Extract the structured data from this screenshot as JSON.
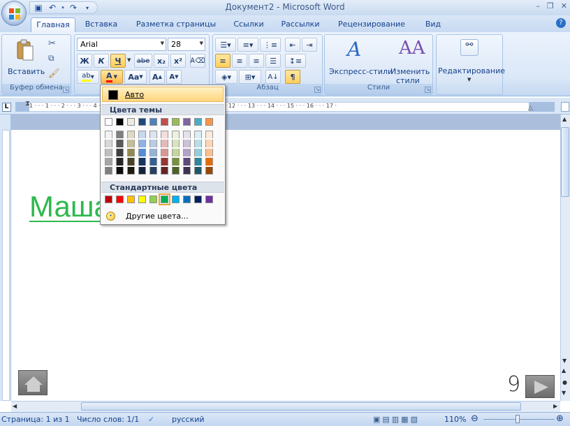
{
  "window": {
    "title": "Документ2 - Microsoft Word"
  },
  "tabs": [
    "Главная",
    "Вставка",
    "Разметка страницы",
    "Ссылки",
    "Рассылки",
    "Рецензирование",
    "Вид"
  ],
  "ribbon": {
    "clipboard": {
      "paste_label": "Вставить",
      "group_label": "Буфер обмена"
    },
    "font": {
      "name": "Arial",
      "size": "28",
      "bold": "Ж",
      "italic": "К",
      "underline": "Ч",
      "strike": "abe",
      "sub": "x₂",
      "sup": "x²",
      "font_color_letter": "A",
      "case": "Aa",
      "grow": "A",
      "shrink": "A"
    },
    "paragraph": {
      "group_label": "Абзац"
    },
    "styles": {
      "express_label": "Экспресс-стили",
      "change_label": "Изменить",
      "change_label2": "стили",
      "group_label": "Стили"
    },
    "editing": {
      "label": "Редактирование"
    }
  },
  "color_menu": {
    "auto_label": "Авто",
    "theme_header": "Цвета темы",
    "standard_header": "Стандартные цвета",
    "more_label": "Другие цвета...",
    "theme_colors": [
      "#ffffff",
      "#000000",
      "#eeece1",
      "#1f497d",
      "#4f81bd",
      "#c0504d",
      "#9bbb59",
      "#8064a2",
      "#4bacc6",
      "#f79646"
    ],
    "theme_shades": [
      [
        "#f2f2f2",
        "#d8d8d8",
        "#bfbfbf",
        "#a5a5a5",
        "#7f7f7f"
      ],
      [
        "#7f7f7f",
        "#595959",
        "#3f3f3f",
        "#262626",
        "#0c0c0c"
      ],
      [
        "#ddd9c3",
        "#c4bd97",
        "#938953",
        "#494429",
        "#1d1b10"
      ],
      [
        "#c6d9f0",
        "#8db3e2",
        "#548dd4",
        "#17365d",
        "#0f243e"
      ],
      [
        "#dbe5f1",
        "#b8cce4",
        "#95b3d7",
        "#366092",
        "#244061"
      ],
      [
        "#f2dcdb",
        "#e5b9b7",
        "#d99694",
        "#953734",
        "#632423"
      ],
      [
        "#ebf1dd",
        "#d7e3bc",
        "#c3d69b",
        "#76923c",
        "#4f6128"
      ],
      [
        "#e5e0ec",
        "#ccc1d9",
        "#b2a2c7",
        "#5f497a",
        "#3f3151"
      ],
      [
        "#dbeef3",
        "#b7dde8",
        "#92cddc",
        "#31859b",
        "#205867"
      ],
      [
        "#fdeada",
        "#fbd5b5",
        "#fac08f",
        "#e36c09",
        "#974806"
      ]
    ],
    "standard_colors": [
      "#c00000",
      "#ff0000",
      "#ffc000",
      "#ffff00",
      "#92d050",
      "#00b050",
      "#00b0f0",
      "#0070c0",
      "#002060",
      "#7030a0"
    ],
    "selected_standard": "#00b050"
  },
  "ruler": {
    "numbers": "1 · · · 1 · · · 2 · · · 3 · · · 4 · · · 5 · · · 6 · · · 7 · · · 8 · · · 9 · · · 10 · · · 11 · · · 12 · · · 13 · · · 14 · · · 15 · · · 16 · · · 17 ·"
  },
  "document": {
    "text": "Маша",
    "text_color": "#2eb84d"
  },
  "slide_number": "9",
  "status": {
    "page": "Страница: 1 из 1",
    "words": "Число слов: 1/1",
    "language": "русский",
    "zoom": "110%"
  }
}
